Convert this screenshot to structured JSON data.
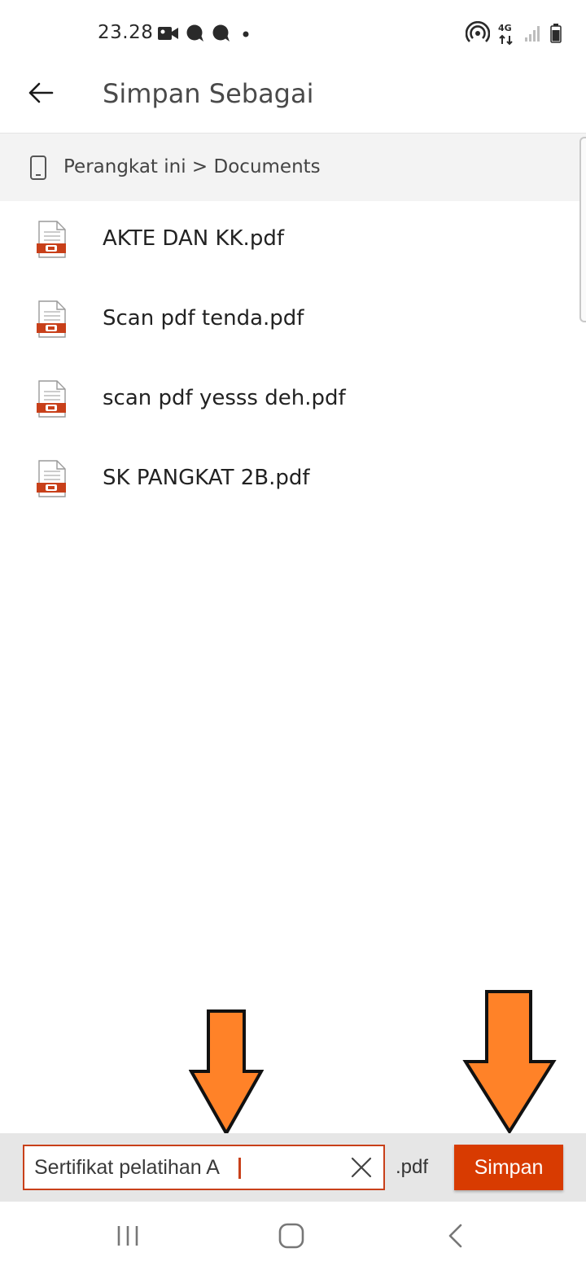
{
  "status_bar": {
    "time": "23.28",
    "network_label": "4G"
  },
  "app_bar": {
    "title": "Simpan Sebagai"
  },
  "breadcrumb": {
    "path": "Perangkat ini > Documents"
  },
  "files": [
    {
      "name": "AKTE DAN KK.pdf",
      "icon": "pdf-file-icon"
    },
    {
      "name": "Scan pdf tenda.pdf",
      "icon": "pdf-file-icon"
    },
    {
      "name": "scan pdf yesss deh.pdf",
      "icon": "pdf-file-icon"
    },
    {
      "name": "SK PANGKAT 2B.pdf",
      "icon": "pdf-file-icon"
    }
  ],
  "save_bar": {
    "filename_value": "Sertifikat pelatihan A",
    "extension": ".pdf",
    "save_label": "Simpan"
  },
  "colors": {
    "accent": "#d83b01",
    "input_border": "#c8401a",
    "pdf_icon": "#c8401a",
    "arrow_fill": "#ff8228",
    "bar_background": "#e6e6e6",
    "breadcrumb_background": "#f3f3f3"
  }
}
